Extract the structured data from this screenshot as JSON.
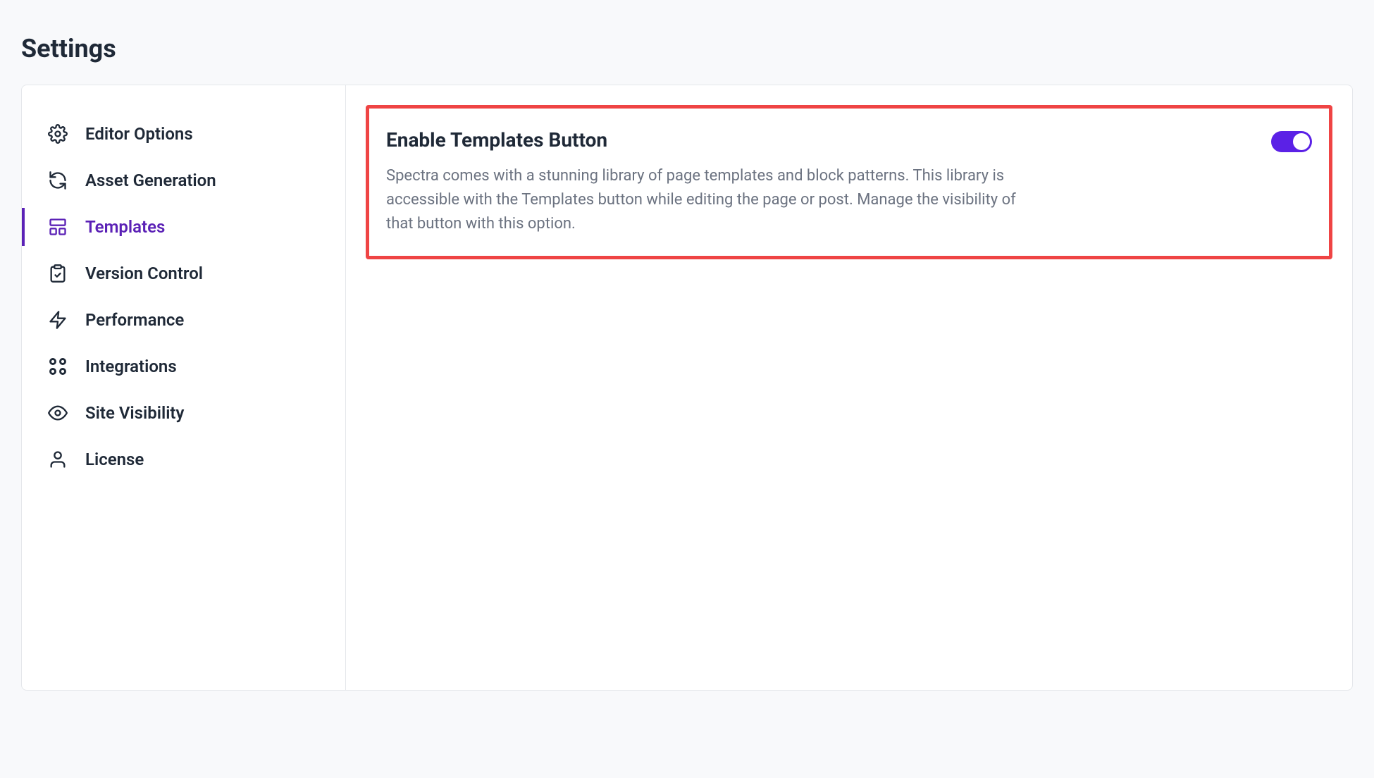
{
  "page_title": "Settings",
  "sidebar": {
    "items": [
      {
        "label": "Editor Options",
        "icon": "gear-icon",
        "active": false
      },
      {
        "label": "Asset Generation",
        "icon": "refresh-icon",
        "active": false
      },
      {
        "label": "Templates",
        "icon": "layout-icon",
        "active": true
      },
      {
        "label": "Version Control",
        "icon": "clipboard-check-icon",
        "active": false
      },
      {
        "label": "Performance",
        "icon": "bolt-icon",
        "active": false
      },
      {
        "label": "Integrations",
        "icon": "grid-icon",
        "active": false
      },
      {
        "label": "Site Visibility",
        "icon": "eye-icon",
        "active": false
      },
      {
        "label": "License",
        "icon": "user-icon",
        "active": false
      }
    ]
  },
  "main": {
    "card": {
      "title": "Enable Templates Button",
      "description": "Spectra comes with a stunning library of page templates and block patterns. This library is accessible with the Templates button while editing the page or post. Manage the visibility of that button with this option.",
      "toggle_on": true
    }
  },
  "colors": {
    "accent": "#5b21e6",
    "highlight_border": "#ef4444"
  }
}
